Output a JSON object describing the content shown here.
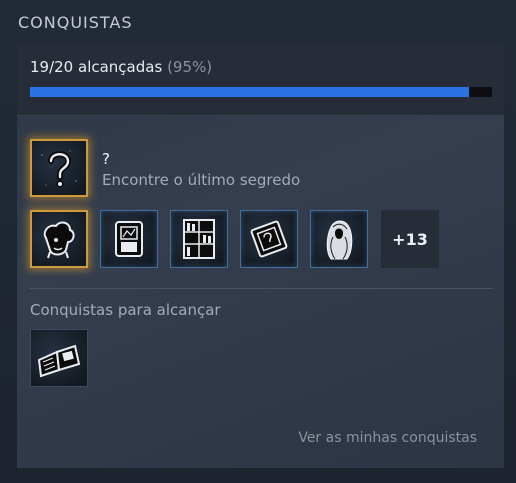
{
  "section_title": "CONQUISTAS",
  "progress": {
    "label": "19/20 alcançadas",
    "percent_label": "(95%)",
    "fraction": 0.95,
    "bar_color": "#2b72e6"
  },
  "featured": {
    "title": "?",
    "description": "Encontre o último segredo",
    "icon": "question-mark-icon"
  },
  "unlocked": [
    {
      "icon": "gingerbread-head-icon",
      "style": "gold"
    },
    {
      "icon": "framed-picture-icon",
      "style": "blue"
    },
    {
      "icon": "bookshelf-icon",
      "style": "blue"
    },
    {
      "icon": "tilted-photo-icon",
      "style": "blue"
    },
    {
      "icon": "woman-portrait-icon",
      "style": "blue"
    }
  ],
  "more_count": "+13",
  "to_get": {
    "title": "Conquistas para alcançar",
    "items": [
      {
        "icon": "open-book-icon",
        "style": "plain"
      }
    ]
  },
  "view_link": "Ver as minhas conquistas"
}
